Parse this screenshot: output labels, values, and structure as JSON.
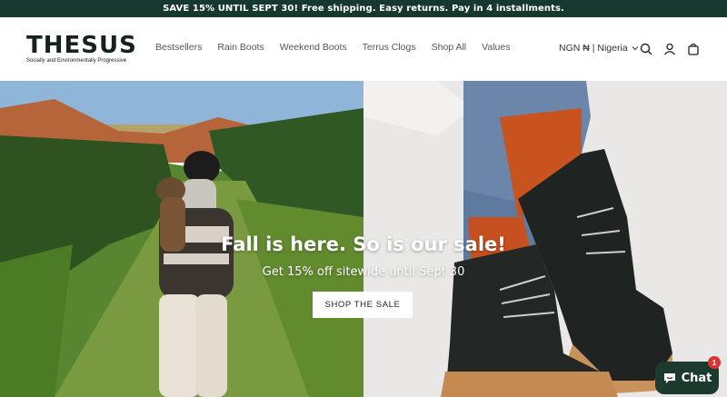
{
  "announcement": "SAVE 15% UNTIL SEPT 30! Free shipping. Easy returns. Pay in 4 installments.",
  "brand": {
    "name": "THESUS",
    "tagline": "Socially and Environmentally Progressive"
  },
  "nav": [
    "Bestsellers",
    "Rain Boots",
    "Weekend Boots",
    "Terrus Clogs",
    "Shop All",
    "Values"
  ],
  "locale": "NGN ₦ | Nigeria",
  "icons": {
    "search": "search-icon",
    "account": "account-icon",
    "cart": "cart-icon",
    "chevron": "chevron-down-icon",
    "chat": "chat-bubble-icon"
  },
  "hero": {
    "title": "Fall is here. So is our sale!",
    "subtitle": "Get 15% off sitewide until Sept 30",
    "cta": "SHOP THE SALE"
  },
  "chat": {
    "label": "Chat",
    "badge": "1"
  },
  "colors": {
    "brand_dark": "#17382e",
    "chat_bg": "#1d3a2f",
    "badge": "#dd3333"
  }
}
